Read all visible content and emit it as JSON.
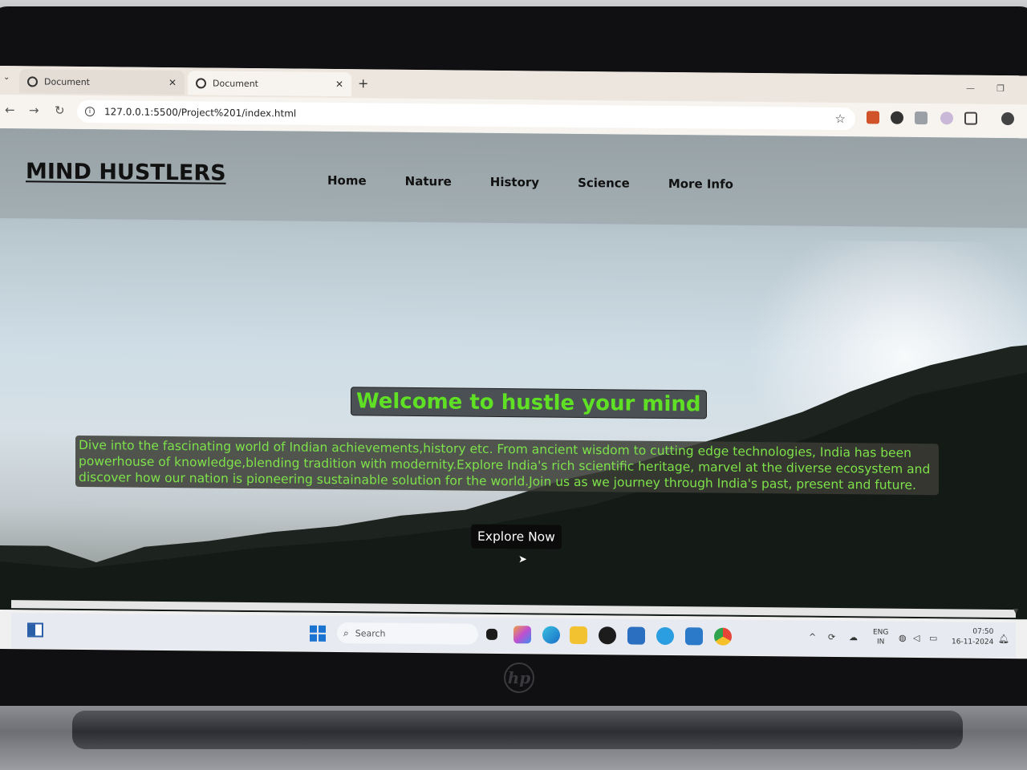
{
  "browser": {
    "tabs": [
      {
        "label": "Document",
        "active": false
      },
      {
        "label": "Document",
        "active": true
      }
    ],
    "url": "127.0.0.1:5500/Project%201/index.html"
  },
  "site": {
    "logo": "MIND HUSTLERS",
    "nav": [
      "Home",
      "Nature",
      "History",
      "Science",
      "More Info"
    ],
    "welcome": "Welcome to hustle your mind",
    "intro": "Dive into the fascinating world of Indian achievements,history etc. From ancient wisdom to cutting edge technologies, India has been powerhouse of knowledge,blending tradition with modernity.Explore India's rich scientific heritage, marvel at the diverse ecosystem and discover how our nation is pioneering sustainable solution for the world.Join us as we journey through India's past, present and future.",
    "cta": "Explore Now",
    "colors": {
      "headline": "#5fe024",
      "body_text": "#7ee24a",
      "cta_bg": "#0b0b0b"
    }
  },
  "taskbar": {
    "search_placeholder": "Search",
    "language": [
      "ENG",
      "IN"
    ],
    "time": "07:50",
    "date": "16-11-2024",
    "apps": [
      "task-view-icon",
      "copilot-icon",
      "edge-icon",
      "file-explorer-icon",
      "whatsapp-icon",
      "store-icon",
      "telegram-icon",
      "vscode-icon",
      "chrome-icon"
    ]
  },
  "laptop": {
    "brand": "hp"
  }
}
